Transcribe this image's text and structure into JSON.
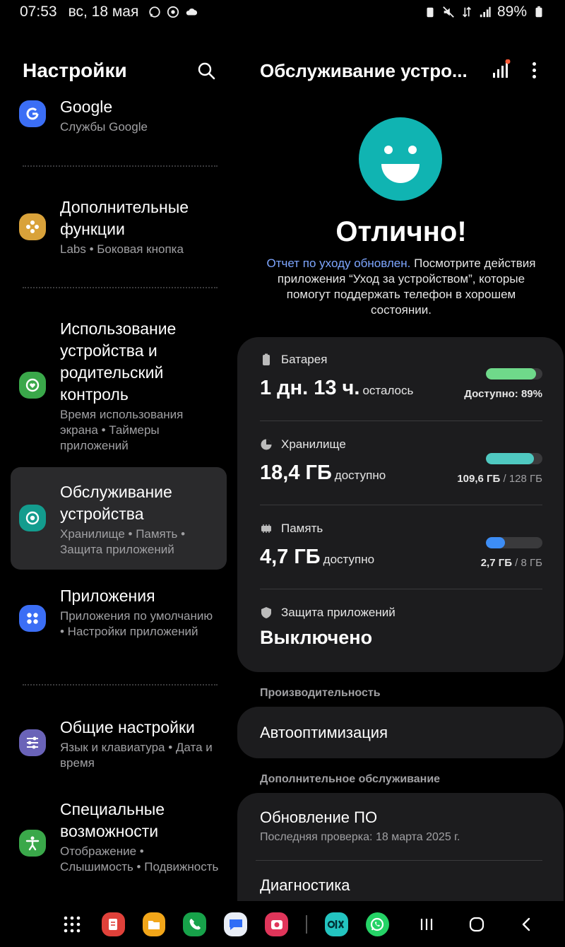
{
  "status_bar": {
    "time": "07:53",
    "date": "вс, 18 мая",
    "battery": "89%"
  },
  "settings": {
    "title": "Настройки",
    "items": [
      {
        "title": "Google",
        "sub": "Службы Google",
        "icon": "google-icon",
        "color": "#3b6ef5"
      },
      {
        "title": "Дополнительные функции",
        "sub": "Labs  •  Боковая кнопка",
        "icon": "gear-flower-icon",
        "color": "#d9a23a"
      },
      {
        "title": "Использование устройства и родительский контроль",
        "sub": "Время использования экрана  •  Таймеры приложений",
        "icon": "digital-wellbeing-icon",
        "color": "#3aa84a"
      },
      {
        "title": "Обслуживание устройства",
        "sub": "Хранилище  •  Память  •  Защита приложений",
        "icon": "device-care-icon",
        "color": "#139c8e"
      },
      {
        "title": "Приложения",
        "sub": "Приложения по умолчанию  •  Настройки приложений",
        "icon": "apps-icon",
        "color": "#3b6ef5"
      },
      {
        "title": "Общие настройки",
        "sub": "Язык и клавиатура  •  Дата и время",
        "icon": "sliders-icon",
        "color": "#6a63b8"
      },
      {
        "title": "Специальные возможности",
        "sub": "Отображение  •  Слышимость  •  Подвижность",
        "icon": "accessibility-icon",
        "color": "#3aa84a"
      }
    ]
  },
  "device_care": {
    "title": "Обслуживание устро...",
    "status": "Отлично!",
    "desc_link": "Отчет по уходу обновлен.",
    "desc_rest": " Посмотрите действия приложения “Уход за устройством”, которые помогут поддержать телефон в хорошем состоянии.",
    "battery": {
      "label": "Батарея",
      "value": "1 дн. 13 ч.",
      "unit": "осталось",
      "right": "Доступно: 89%",
      "fill": 0.89,
      "color": "#6fd98a"
    },
    "storage": {
      "label": "Хранилище",
      "value": "18,4 ГБ",
      "unit": "доступно",
      "right_used": "109,6 ГБ",
      "right_total": " / 128 ГБ",
      "fill": 0.856,
      "color": "#4fc9c1"
    },
    "memory": {
      "label": "Память",
      "value": "4,7 ГБ",
      "unit": "доступно",
      "right_used": "2,7 ГБ",
      "right_total": " / 8 ГБ",
      "fill": 0.3375,
      "color": "#3d8df5"
    },
    "protection": {
      "label": "Защита приложений",
      "value": "Выключено"
    },
    "perf_label": "Производительность",
    "auto_opt": "Автооптимизация",
    "extra_label": "Дополнительное обслуживание",
    "update_title": "Обновление ПО",
    "update_sub": "Последняя проверка: 18 марта 2025 г.",
    "diagnostics": "Диагностика"
  },
  "dock": [
    {
      "icon": "app-drawer-icon"
    },
    {
      "icon": "notes-icon",
      "color": "#e0413a"
    },
    {
      "icon": "files-icon",
      "color": "#f2a619"
    },
    {
      "icon": "phone-icon",
      "color": "#17a24a"
    },
    {
      "icon": "messages-icon",
      "color": "#e9eef7"
    },
    {
      "icon": "camera-app-icon",
      "color": "#e0355a"
    },
    {
      "icon": "olx-icon",
      "color": "#23c4c0"
    },
    {
      "icon": "whatsapp-icon",
      "color": "#25d366"
    }
  ]
}
